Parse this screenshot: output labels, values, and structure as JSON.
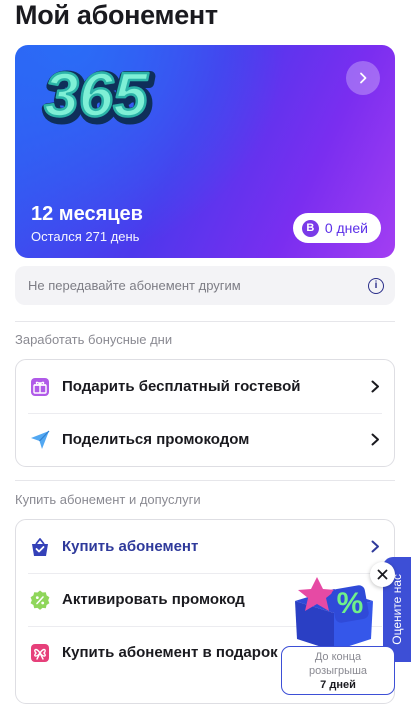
{
  "header": {
    "title": "Мой абонемент"
  },
  "hero": {
    "logo_text": "365",
    "months": "12 месяцев",
    "remaining": "Остался 271 день",
    "days_badge_letter": "B",
    "days_label": "0 дней"
  },
  "notice": {
    "text": "Не передавайте абонемент другим"
  },
  "earn_section": {
    "title": "Заработать бонусные дни",
    "items": [
      {
        "label": "Подарить бесплатный гостевой",
        "icon": "gift-icon"
      },
      {
        "label": "Поделиться промокодом",
        "icon": "send-icon"
      }
    ]
  },
  "buy_section": {
    "title": "Купить абонемент и допуслуги",
    "items": [
      {
        "label": "Купить абонемент",
        "icon": "bag-icon"
      },
      {
        "label": "Активировать промокод",
        "icon": "percent-badge-icon"
      },
      {
        "label": "Купить абонемент в подарок",
        "icon": "gift-bow-icon"
      }
    ]
  },
  "rate_tab": {
    "label": "Оцените нас"
  },
  "giveaway": {
    "line1": "До конца",
    "line2": "розыгрыша",
    "line3": "7 дней"
  },
  "colors": {
    "accent_blue": "#3d4fd6",
    "gradient_start": "#2f5ff3",
    "gradient_end": "#a33ef2",
    "link_navy": "#2f3a9b"
  }
}
